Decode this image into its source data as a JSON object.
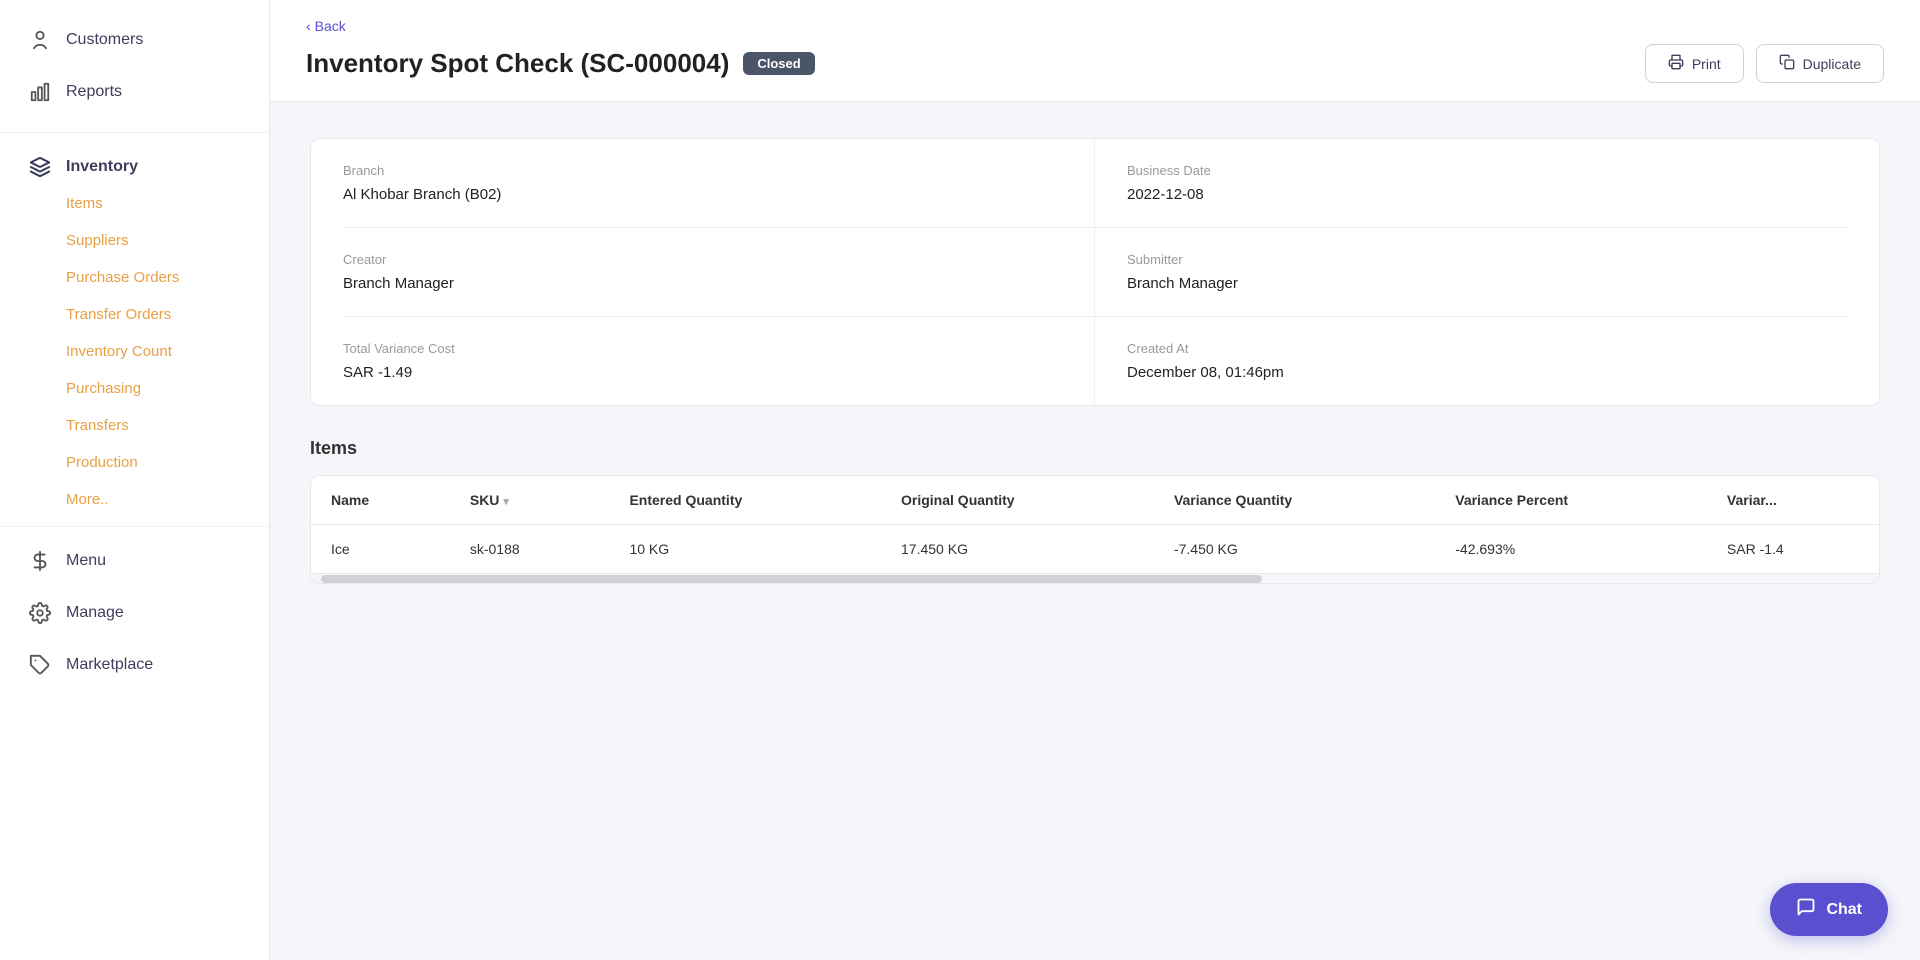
{
  "sidebar": {
    "top_items": [
      {
        "id": "customers",
        "label": "Customers",
        "icon": "person"
      },
      {
        "id": "reports",
        "label": "Reports",
        "icon": "chart"
      }
    ],
    "inventory_group": {
      "label": "Inventory",
      "icon": "layers",
      "sub_items": [
        {
          "id": "items",
          "label": "Items"
        },
        {
          "id": "suppliers",
          "label": "Suppliers"
        },
        {
          "id": "purchase-orders",
          "label": "Purchase Orders"
        },
        {
          "id": "transfer-orders",
          "label": "Transfer Orders"
        },
        {
          "id": "inventory-count",
          "label": "Inventory Count"
        },
        {
          "id": "purchasing",
          "label": "Purchasing"
        },
        {
          "id": "transfers",
          "label": "Transfers"
        },
        {
          "id": "production",
          "label": "Production"
        },
        {
          "id": "more",
          "label": "More.."
        }
      ]
    },
    "bottom_items": [
      {
        "id": "menu",
        "label": "Menu",
        "icon": "utensils"
      },
      {
        "id": "manage",
        "label": "Manage",
        "icon": "gear"
      },
      {
        "id": "marketplace",
        "label": "Marketplace",
        "icon": "puzzle"
      }
    ]
  },
  "header": {
    "back_label": "Back",
    "title": "Inventory Spot Check (SC-000004)",
    "status": "Closed",
    "print_label": "Print",
    "duplicate_label": "Duplicate"
  },
  "info_card": {
    "branch_label": "Branch",
    "branch_value": "Al Khobar Branch (B02)",
    "business_date_label": "Business Date",
    "business_date_value": "2022-12-08",
    "creator_label": "Creator",
    "creator_value": "Branch Manager",
    "submitter_label": "Submitter",
    "submitter_value": "Branch Manager",
    "total_variance_cost_label": "Total Variance Cost",
    "total_variance_cost_value": "SAR -1.49",
    "created_at_label": "Created At",
    "created_at_value": "December 08, 01:46pm"
  },
  "items_section": {
    "title": "Items",
    "columns": [
      "Name",
      "SKU",
      "Entered Quantity",
      "Original Quantity",
      "Variance Quantity",
      "Variance Percent",
      "Variar..."
    ],
    "rows": [
      {
        "name": "Ice",
        "sku": "sk-0188",
        "entered_qty": "10 KG",
        "original_qty": "17.450 KG",
        "variance_qty": "-7.450 KG",
        "variance_percent": "-42.693%",
        "variance_cost": "SAR -1.4"
      }
    ]
  },
  "chat": {
    "label": "Chat"
  }
}
